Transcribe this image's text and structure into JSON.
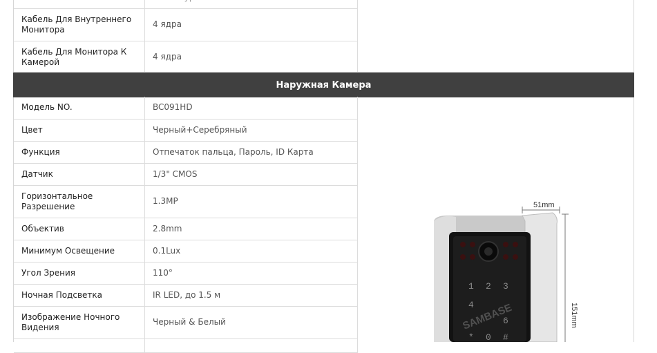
{
  "top_rows": [
    {
      "label": "",
      "value": "... ...  ...  ур"
    },
    {
      "label": "Кабель Для Внутреннего Монитора",
      "value": "4 ядра"
    },
    {
      "label": "Кабель Для Монитора К Камерой",
      "value": "4 ядра"
    }
  ],
  "section": {
    "title": "Наружная Камера"
  },
  "rows": [
    {
      "label": "Модель NO.",
      "value": "BC091HD"
    },
    {
      "label": "Цвет",
      "value": "Черный+Серебряный"
    },
    {
      "label": "Функция",
      "value": "Отпечаток пальца, Пароль, ID Карта"
    },
    {
      "label": "Датчик",
      "value": "1/3\" CMOS"
    },
    {
      "label": "Горизонтальное Разрешение",
      "value": "1.3MP"
    },
    {
      "label": "Объектив",
      "value": "2.8mm"
    },
    {
      "label": "Минимум Освещение",
      "value": "0.1Lux"
    },
    {
      "label": "Угол Зрения",
      "value": "110°"
    },
    {
      "label": "Ночная Подсветка",
      "value": "IR LED, до 1.5 м"
    },
    {
      "label": "Изображение Ночного Видения",
      "value": "Черный & Белый"
    }
  ],
  "product_image": {
    "width_label": "51mm",
    "height_label": "151mm",
    "watermark": "SAMBASE"
  }
}
